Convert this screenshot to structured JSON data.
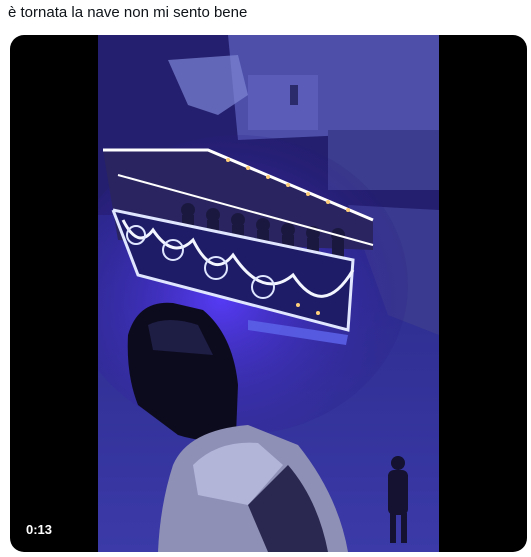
{
  "post": {
    "text": "è tornata la nave non mi sento bene"
  },
  "video": {
    "timestamp": "0:13"
  }
}
